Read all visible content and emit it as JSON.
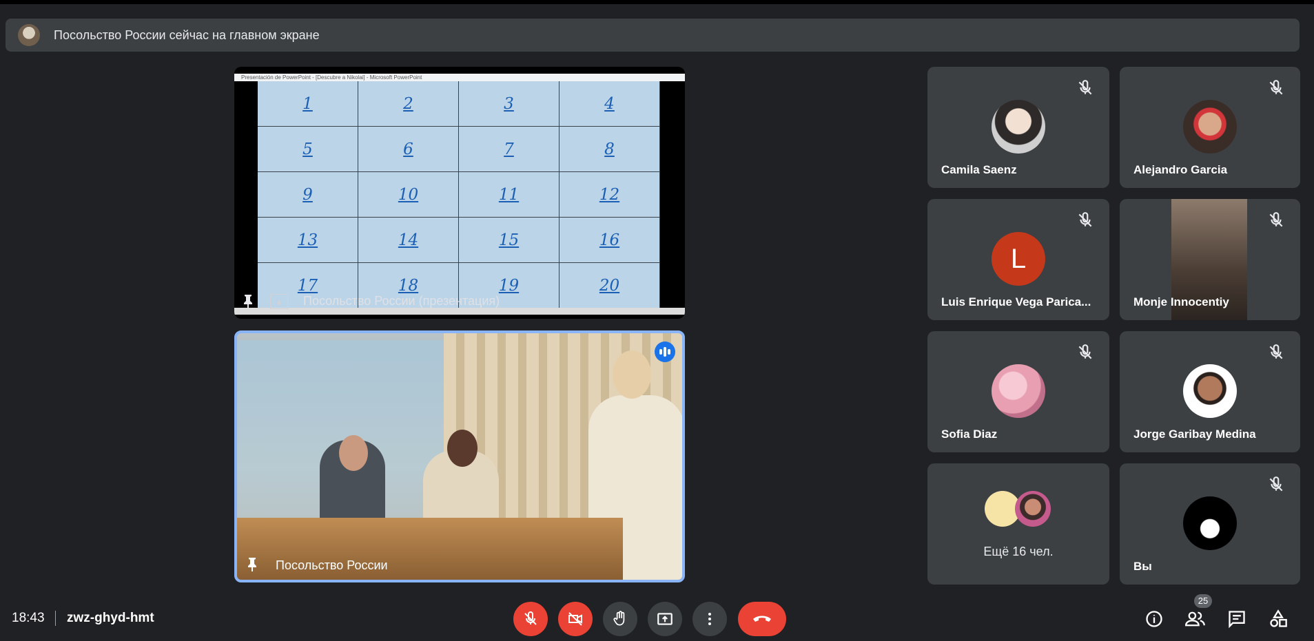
{
  "banner": {
    "text": "Посольство России сейчас на главном экране"
  },
  "presentation": {
    "window_title": "Presentación de PowerPoint - [Descubre a Nikolai] - Microsoft PowerPoint",
    "cells": [
      "1",
      "2",
      "3",
      "4",
      "5",
      "6",
      "7",
      "8",
      "9",
      "10",
      "11",
      "12",
      "13",
      "14",
      "15",
      "16",
      "17",
      "18",
      "19",
      "20"
    ],
    "label": "Посольство России (презентация)"
  },
  "speaker": {
    "label": "Посольство России"
  },
  "participants": [
    {
      "name": "Camila Saenz"
    },
    {
      "name": "Alejandro Garcia"
    },
    {
      "name": "Luis Enrique Vega Parica...",
      "initial": "L"
    },
    {
      "name": "Monje Innocentiy"
    },
    {
      "name": "Sofia Diaz"
    },
    {
      "name": "Jorge Garibay Medina"
    },
    {
      "more": "Ещё 16 чел."
    },
    {
      "name": "Вы"
    }
  ],
  "bottom": {
    "time": "18:43",
    "meeting_code": "zwz-ghyd-hmt",
    "people_count": "25"
  },
  "colors": {
    "background": "#202124",
    "tile": "#3c4043",
    "red": "#ea4335",
    "accent": "#8ab4f8"
  }
}
